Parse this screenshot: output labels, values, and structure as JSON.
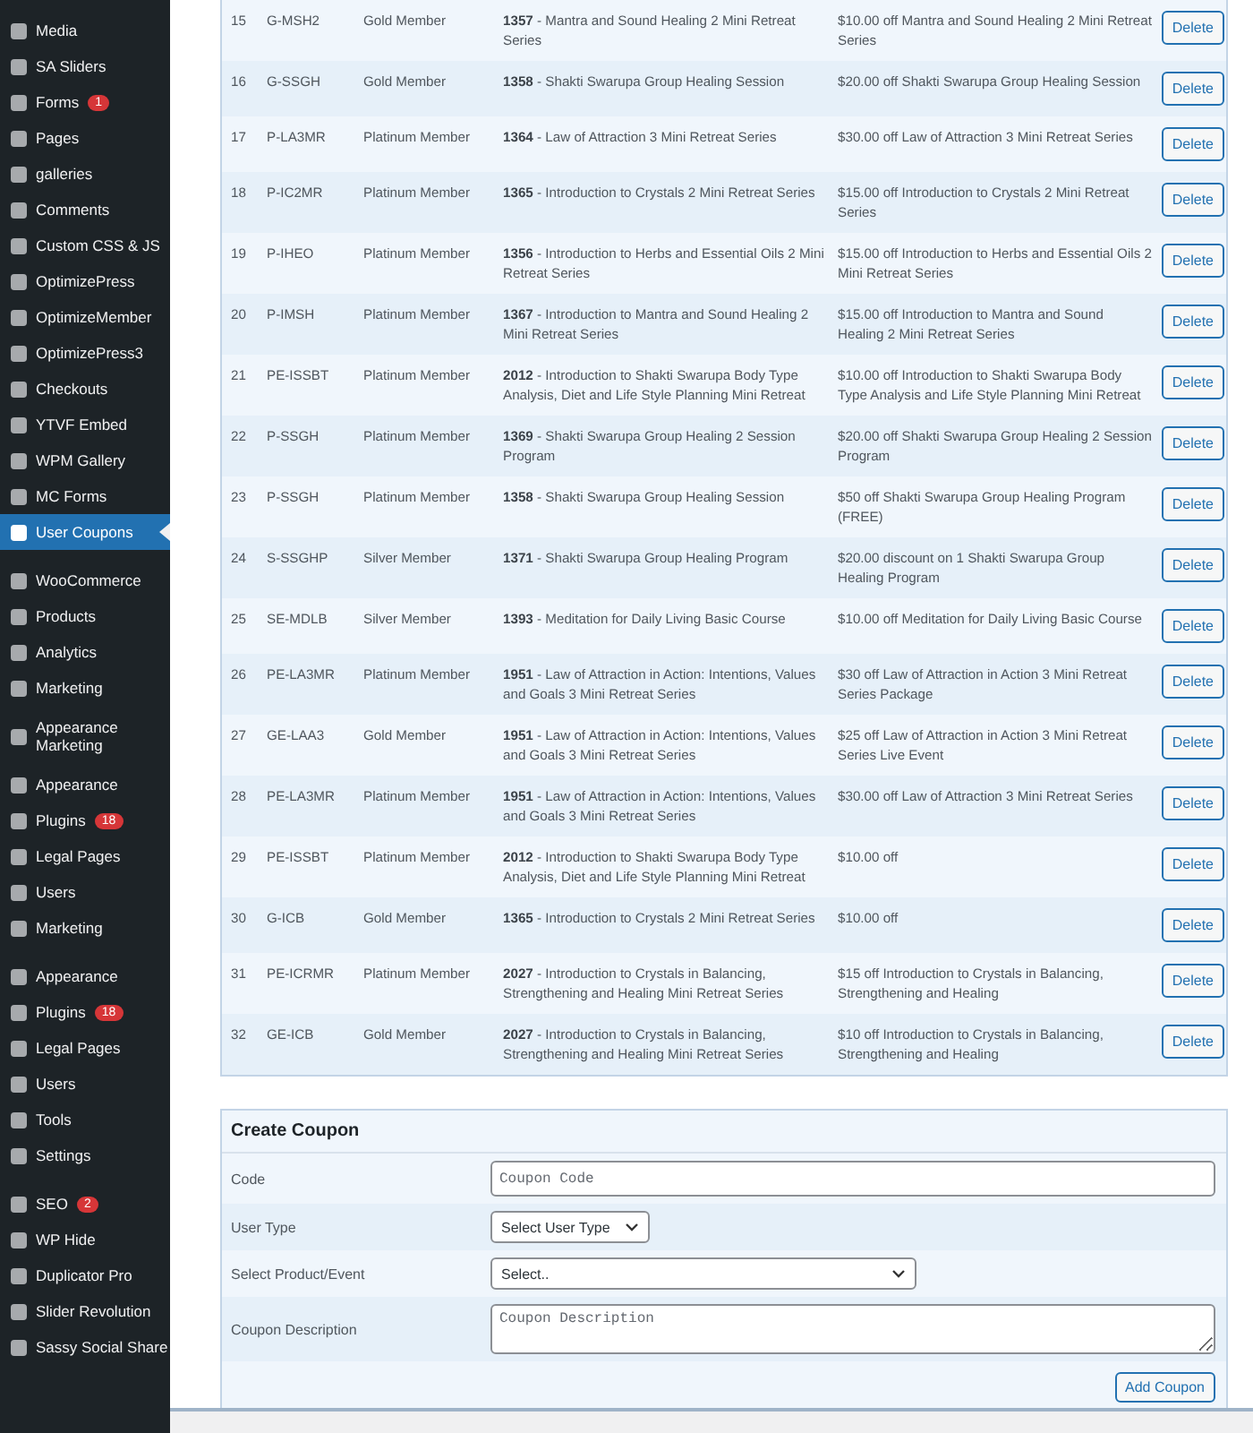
{
  "sidebar": {
    "groups": [
      [
        {
          "label": "Media",
          "selected": false
        },
        {
          "label": "SA Sliders",
          "selected": false
        },
        {
          "label": "Forms",
          "badge": "1",
          "selected": false
        },
        {
          "label": "Pages",
          "selected": false
        },
        {
          "label": "galleries",
          "selected": false
        },
        {
          "label": "Comments",
          "selected": false
        },
        {
          "label": "Custom CSS & JS",
          "selected": false
        },
        {
          "label": "OptimizePress",
          "selected": false
        },
        {
          "label": "OptimizeMember",
          "selected": false
        },
        {
          "label": "OptimizePress3",
          "selected": false
        },
        {
          "label": "Checkouts",
          "selected": false
        },
        {
          "label": "YTVF Embed",
          "selected": false
        },
        {
          "label": "WPM Gallery",
          "selected": false
        },
        {
          "label": "MC Forms",
          "selected": false
        },
        {
          "label": "User Coupons",
          "selected": true
        }
      ],
      [
        {
          "label": "WooCommerce",
          "selected": false
        },
        {
          "label": "Products",
          "selected": false
        },
        {
          "label": "Analytics",
          "selected": false
        },
        {
          "label": "Marketing",
          "selected": false
        }
      ],
      [
        {
          "label": "Appearance",
          "overlap_label": "Marketing",
          "selected": false
        }
      ],
      [
        {
          "label": "Appearance",
          "selected": false
        },
        {
          "label": "Plugins",
          "badge": "18",
          "selected": false
        },
        {
          "label": "Legal Pages",
          "selected": false
        },
        {
          "label": "Users",
          "selected": false
        },
        {
          "label": "Marketing",
          "selected": false
        }
      ],
      [
        {
          "label": "Appearance",
          "selected": false
        },
        {
          "label": "Plugins",
          "badge": "18",
          "selected": false
        },
        {
          "label": "Legal Pages",
          "selected": false
        },
        {
          "label": "Users",
          "selected": false
        },
        {
          "label": "Tools",
          "selected": false
        },
        {
          "label": "Settings",
          "selected": false
        }
      ],
      [
        {
          "label": "SEO",
          "badge": "2",
          "selected": false
        },
        {
          "label": "WP Hide",
          "selected": false
        },
        {
          "label": "Duplicator Pro",
          "selected": false
        },
        {
          "label": "Slider Revolution",
          "selected": false
        },
        {
          "label": "Sassy Social Share",
          "selected": false
        }
      ]
    ]
  },
  "coupons": {
    "rows": [
      {
        "number": "15",
        "code": "G-MSH2",
        "user_type": "Gold Member",
        "product": "**1357** - Mantra and Sound Healing 2 Mini Retreat Series",
        "description": "$10.00 off Mantra and Sound Healing 2 Mini Retreat Series",
        "action": "Delete"
      },
      {
        "number": "16",
        "code": "G-SSGH",
        "user_type": "Gold Member",
        "product": "**1358** - Shakti Swarupa Group Healing Session",
        "description": "$20.00 off Shakti Swarupa Group Healing Session",
        "action": "Delete"
      },
      {
        "number": "17",
        "code": "P-LA3MR",
        "user_type": "Platinum Member",
        "product": "**1364** - Law of Attraction 3 Mini Retreat Series",
        "description": "$30.00 off Law of Attraction 3 Mini Retreat Series",
        "action": "Delete"
      },
      {
        "number": "18",
        "code": "P-IC2MR",
        "user_type": "Platinum Member",
        "product": "**1365** - Introduction to Crystals 2 Mini Retreat Series",
        "description": "$15.00 off Introduction to Crystals 2 Mini Retreat Series",
        "action": "Delete"
      },
      {
        "number": "19",
        "code": "P-IHEO",
        "user_type": "Platinum Member",
        "product": "**1356** - Introduction to Herbs and Essential Oils 2 Mini Retreat Series",
        "description": "$15.00 off Introduction to Herbs and Essential Oils 2 Mini Retreat Series",
        "action": "Delete"
      },
      {
        "number": "20",
        "code": "P-IMSH",
        "user_type": "Platinum Member",
        "product": "**1367** - Introduction to Mantra and Sound Healing 2 Mini Retreat Series",
        "description": "$15.00 off Introduction to Mantra and Sound Healing 2 Mini Retreat Series",
        "action": "Delete"
      },
      {
        "number": "21",
        "code": "PE-ISSBT",
        "user_type": "Platinum Member",
        "product": "**2012** - Introduction to Shakti Swarupa Body Type Analysis, Diet and Life Style Planning Mini Retreat",
        "description": "$10.00 off Introduction to Shakti Swarupa Body Type Analysis and Life Style Planning Mini Retreat",
        "action": "Delete"
      },
      {
        "number": "22",
        "code": "P-SSGH",
        "user_type": "Platinum Member",
        "product": "**1369** - Shakti Swarupa Group Healing 2 Session Program",
        "description": "$20.00 off Shakti Swarupa Group Healing 2 Session Program",
        "action": "Delete"
      },
      {
        "number": "23",
        "code": "P-SSGH",
        "user_type": "Platinum Member",
        "product": "**1358** - Shakti Swarupa Group Healing Session",
        "description": "$50 off Shakti Swarupa Group Healing Program (FREE)",
        "action": "Delete"
      },
      {
        "number": "24",
        "code": "S-SSGHP",
        "user_type": "Silver Member",
        "product": "**1371** - Shakti Swarupa Group Healing Program",
        "description": "$20.00 discount on 1 Shakti Swarupa Group Healing Program",
        "action": "Delete"
      },
      {
        "number": "25",
        "code": "SE-MDLB",
        "user_type": "Silver Member",
        "product": "**1393** - Meditation for Daily Living Basic Course",
        "description": "$10.00 off Meditation for Daily Living Basic Course",
        "action": "Delete"
      },
      {
        "number": "26",
        "code": "PE-LA3MR",
        "user_type": "Platinum Member",
        "product": "**1951** - Law of Attraction in Action: Intentions, Values and Goals 3 Mini Retreat Series",
        "description": "$30 off Law of Attraction in Action 3 Mini Retreat Series Package",
        "action": "Delete"
      },
      {
        "number": "27",
        "code": "GE-LAA3",
        "user_type": "Gold Member",
        "product": "**1951** - Law of Attraction in Action: Intentions, Values and Goals 3 Mini Retreat Series",
        "description": "$25 off Law of Attraction in Action 3 Mini Retreat Series Live Event",
        "action": "Delete"
      },
      {
        "number": "28",
        "code": "PE-LA3MR",
        "user_type": "Platinum Member",
        "product": "**1951** - Law of Attraction in Action: Intentions, Values and Goals 3 Mini Retreat Series",
        "description": "$30.00 off Law of Attraction 3 Mini Retreat Series",
        "action": "Delete"
      },
      {
        "number": "29",
        "code": "PE-ISSBT",
        "user_type": "Platinum Member",
        "product": "**2012** - Introduction to Shakti Swarupa Body Type Analysis, Diet and Life Style Planning Mini Retreat",
        "description": "$10.00 off",
        "action": "Delete"
      },
      {
        "number": "30",
        "code": "G-ICB",
        "user_type": "Gold Member",
        "product": "**1365** - Introduction to Crystals 2 Mini Retreat Series",
        "description": "$10.00 off",
        "action": "Delete"
      },
      {
        "number": "31",
        "code": "PE-ICRMR",
        "user_type": "Platinum Member",
        "product": "**2027** - Introduction to Crystals in Balancing, Strengthening and Healing Mini Retreat Series",
        "description": "$15 off Introduction to Crystals in Balancing, Strengthening and Healing",
        "action": "Delete"
      },
      {
        "number": "32",
        "code": "GE-ICB",
        "user_type": "Gold Member",
        "product": "**2027** - Introduction to Crystals in Balancing, Strengthening and Healing Mini Retreat Series",
        "description": "$10 off Introduction to Crystals in Balancing, Strengthening and Healing",
        "action": "Delete"
      }
    ]
  },
  "create_coupon": {
    "title": "Create Coupon",
    "fields": [
      {
        "kind": "text",
        "label": "Code",
        "placeholder": "Coupon Code"
      },
      {
        "kind": "select",
        "label": "User Type",
        "value": "Select User Type"
      },
      {
        "kind": "select",
        "label": "Select Product/Event",
        "value": "Select.."
      },
      {
        "kind": "textarea",
        "label": "Coupon Description",
        "placeholder": "Coupon Description"
      }
    ],
    "button": "Add Coupon"
  }
}
